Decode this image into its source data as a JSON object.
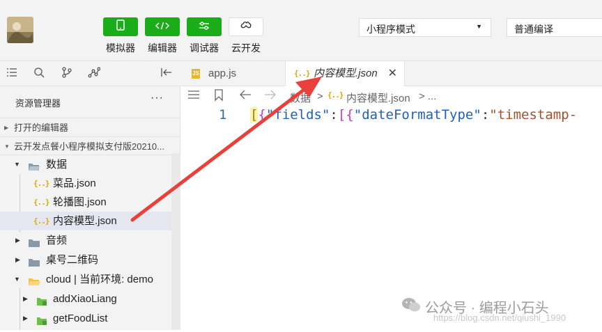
{
  "toolbar": {
    "buttons": [
      {
        "label": "模拟器",
        "icon": "phone-icon"
      },
      {
        "label": "编辑器",
        "icon": "code-icon"
      },
      {
        "label": "调试器",
        "icon": "debug-icon"
      },
      {
        "label": "云开发",
        "icon": "cloud-icon"
      }
    ],
    "mode_select": "小程序模式",
    "compile_select": "普通编译"
  },
  "sidebar": {
    "explorer_title": "资源管理器",
    "more": "···",
    "open_editors": "打开的编辑器",
    "project": "云开发点餐小程序模拟支付版20210...",
    "tree": [
      {
        "label": "数据",
        "type": "folder-open"
      },
      {
        "label": "菜品.json",
        "type": "json"
      },
      {
        "label": "轮播图.json",
        "type": "json"
      },
      {
        "label": "内容模型.json",
        "type": "json",
        "selected": true
      },
      {
        "label": "音频",
        "type": "folder"
      },
      {
        "label": "桌号二维码",
        "type": "folder"
      },
      {
        "label": "cloud | 当前环境: demo",
        "type": "cloud-folder"
      },
      {
        "label": "addXiaoLiang",
        "type": "cloud-fn"
      },
      {
        "label": "getFoodList",
        "type": "cloud-fn"
      }
    ]
  },
  "editor": {
    "tabs": [
      {
        "label": "app.js",
        "badge": "JS"
      },
      {
        "label": "内容模型.json",
        "badge": "{..}",
        "active": true
      }
    ],
    "close": "✕",
    "breadcrumb": {
      "folder": "数据",
      "sep": ">",
      "file": "内容模型.json",
      "tail": "> ..."
    },
    "line_number": "1",
    "code": {
      "b1": "[",
      "b2": "{",
      "k1": "\"fields\"",
      "c1": ":",
      "b3": "[",
      "b4": "{",
      "k2": "\"dateFormatType\"",
      "c2": ":",
      "v1": "\"timestamp-"
    }
  },
  "watermark": {
    "text": "公众号 · 编程小石头",
    "url": "https://blog.csdn.net/qiushi_1990"
  },
  "colors": {
    "accent": "#1aad19",
    "arrow": "#e8403a"
  }
}
